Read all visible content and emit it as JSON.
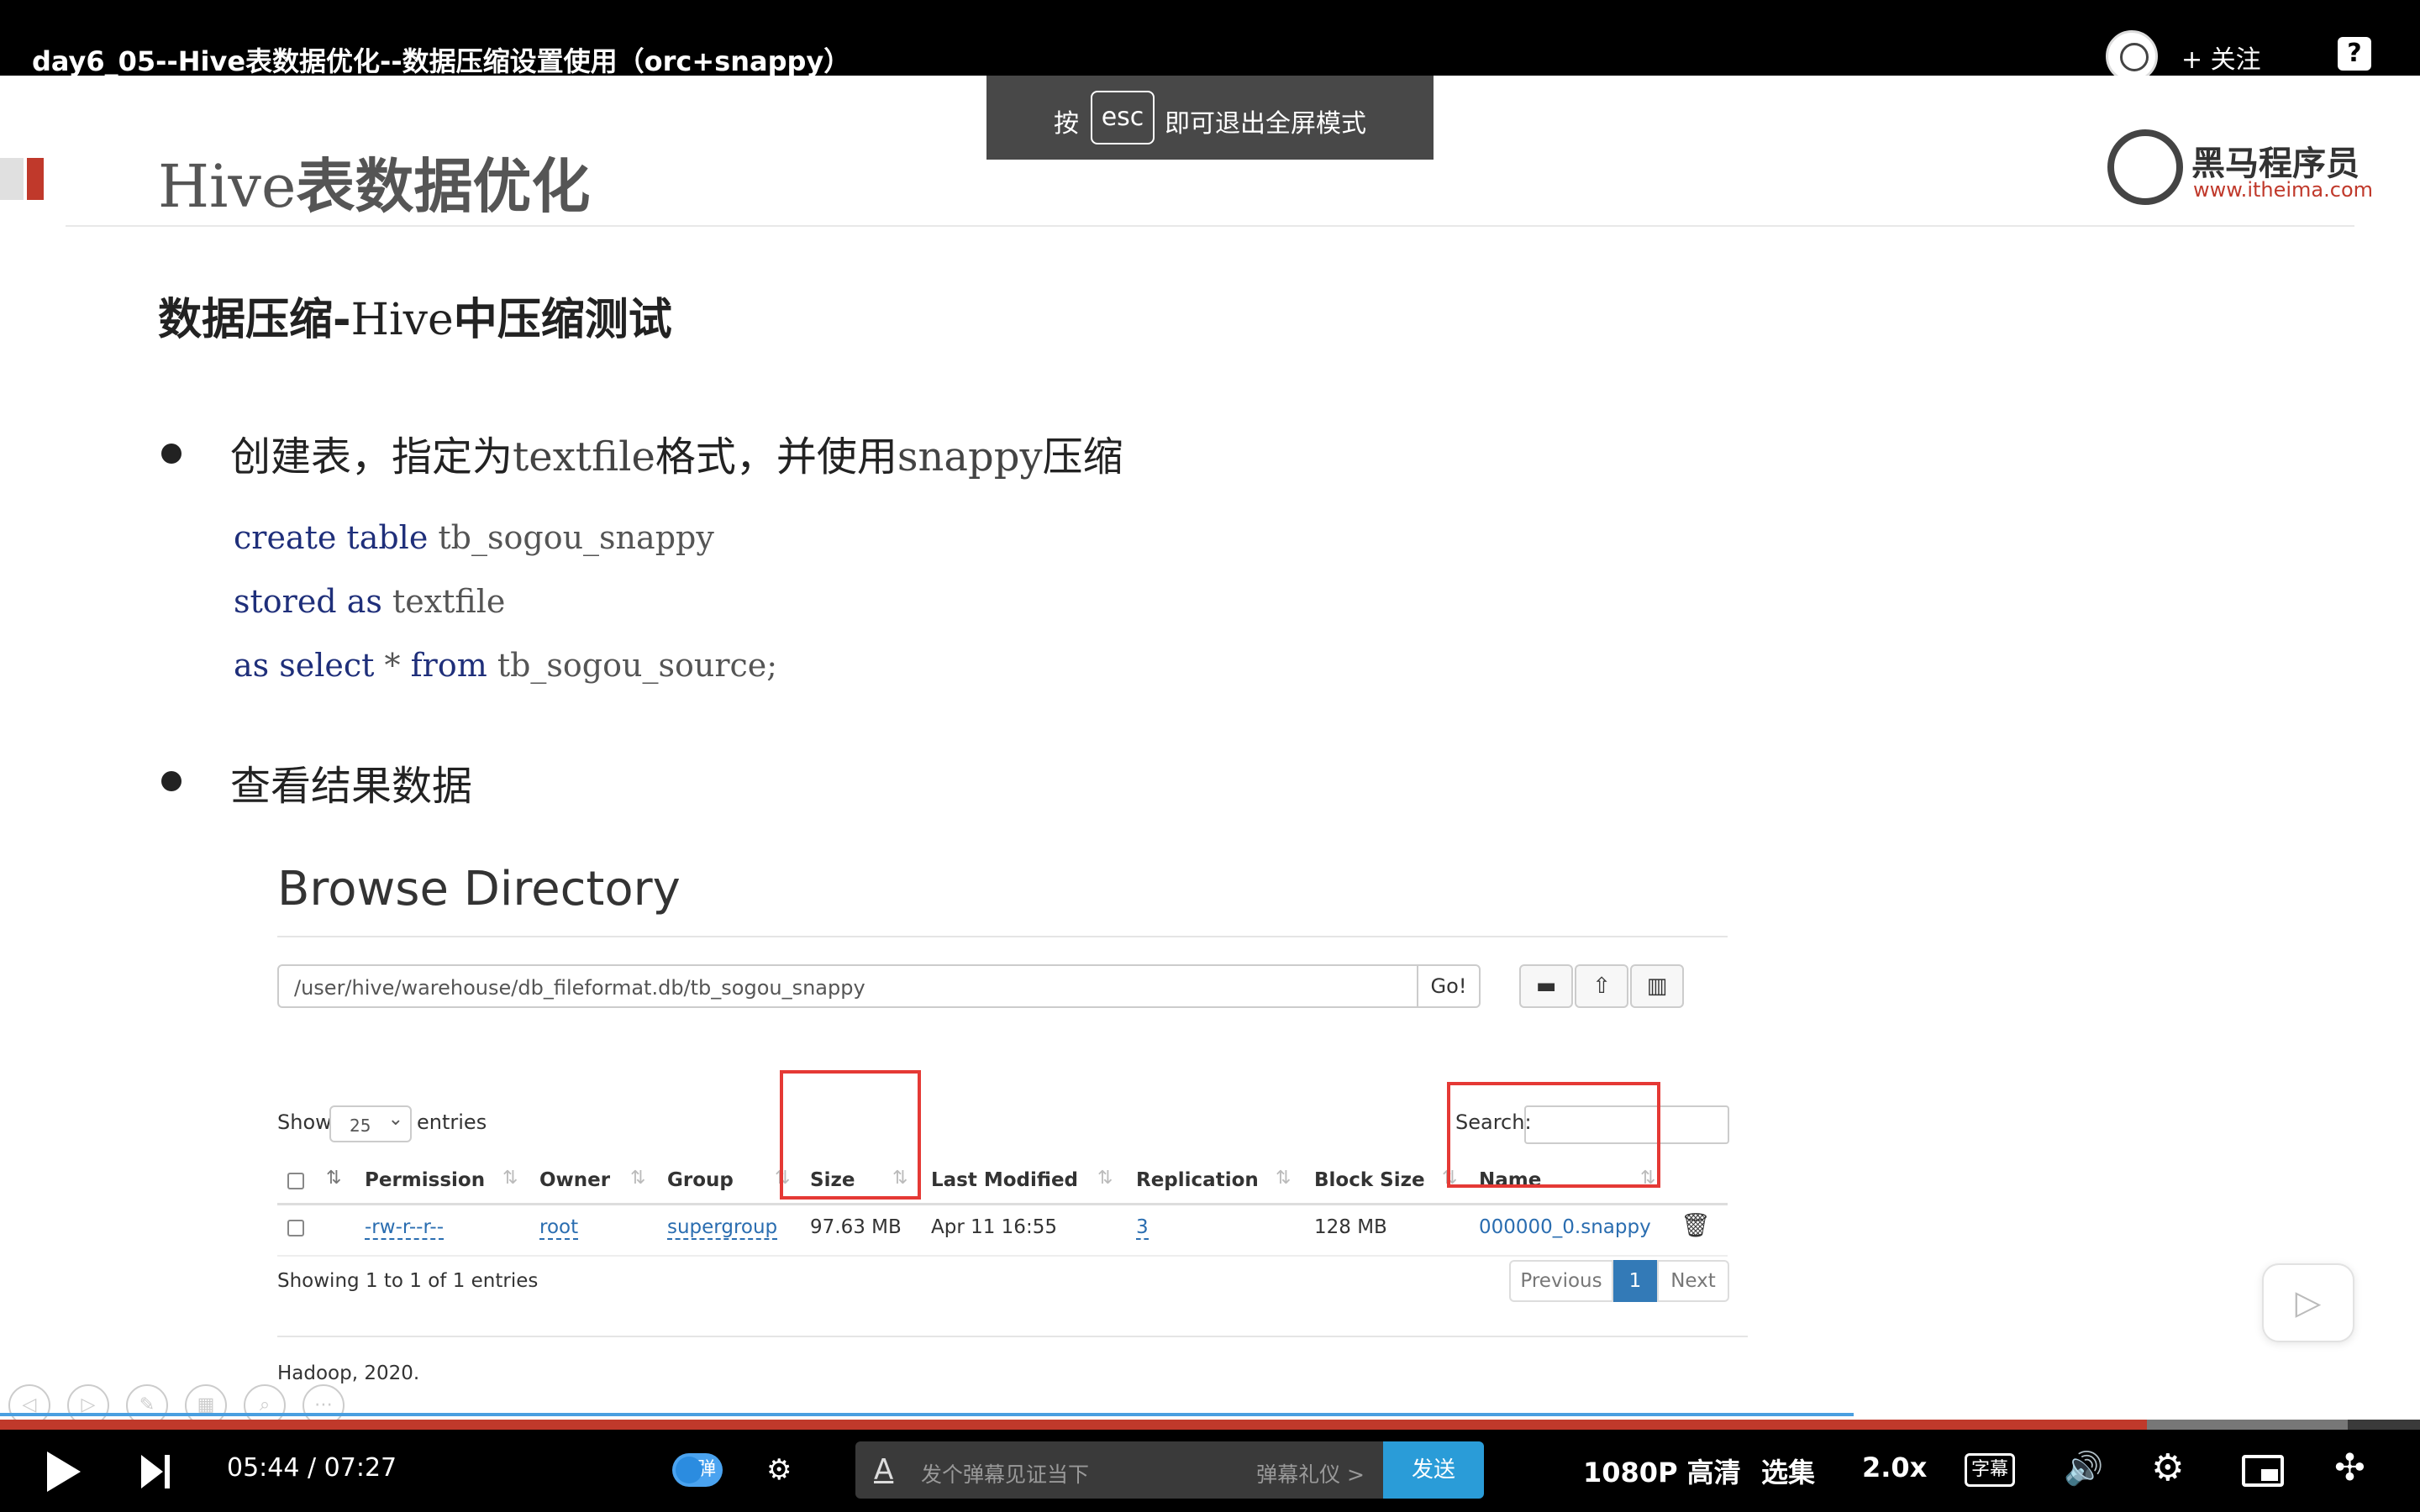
{
  "player": {
    "video_title": "day6_05--Hive表数据优化--数据压缩设置使用（orc+snappy）",
    "follow_label": "+ 关注",
    "help_icon": "?",
    "esc_toast": {
      "pre": "按",
      "key": "esc",
      "post": "即可退出全屏模式"
    }
  },
  "slide": {
    "title_mono": "Hive",
    "title_cn": "表数据优化",
    "logo_text": "黑马程序员",
    "logo_url": "www.itheima.com",
    "heading_pre": "数据压缩-",
    "heading_mono": "Hive",
    "heading_post": "中压缩测试",
    "bullet1": {
      "part1": "创建表，指定为",
      "mono1": "textfile",
      "part2": "格式，并使用",
      "mono2": "snappy",
      "part3": "压缩"
    },
    "code": {
      "line1_kw": "create table",
      "line1_rest": " tb_sogou_snappy",
      "line2_kw": "stored as",
      "line2_rest": " textfile",
      "line3_kw1": "as select",
      "line3_mid": " * ",
      "line3_kw2": "from",
      "line3_rest": " tb_sogou_source;"
    },
    "bullet2": "查看结果数据"
  },
  "hdfs": {
    "title": "Browse Directory",
    "path": "/user/hive/warehouse/db_fileformat.db/tb_sogou_snappy",
    "go_label": "Go!",
    "show_label": "Show",
    "show_value": "25",
    "entries_label": "entries",
    "search_label": "Search:",
    "columns": [
      "Permission",
      "Owner",
      "Group",
      "Size",
      "Last Modified",
      "Replication",
      "Block Size",
      "Name"
    ],
    "row": {
      "permission": "-rw-r--r--",
      "owner": "root",
      "group": "supergroup",
      "size": "97.63 MB",
      "last_modified": "Apr 11 16:55",
      "replication": "3",
      "block_size": "128 MB",
      "name": "000000_0.snappy"
    },
    "showing": "Showing 1 to 1 of 1 entries",
    "pagination": {
      "previous": "Previous",
      "current": "1",
      "next": "Next"
    },
    "footer": "Hadoop, 2020."
  },
  "controls": {
    "current_time": "05:44",
    "separator": "/",
    "total_time": "07:27",
    "progress": 0.887,
    "buffered": 0.97,
    "slide_progress": 0.766,
    "danmaku_toggle": "弹",
    "danmaku_placeholder": "发个弹幕见证当下",
    "danmaku_etiquette": "弹幕礼仪 >",
    "send_label": "发送",
    "quality": "1080P 高清",
    "episodes": "选集",
    "speed": "2.0x",
    "subtitle_icon": "字幕"
  },
  "colors": {
    "accent_red": "#c0392b",
    "send_blue": "#2a9cd8",
    "highlight": "#e53935",
    "link_blue": "#2a6db0"
  }
}
